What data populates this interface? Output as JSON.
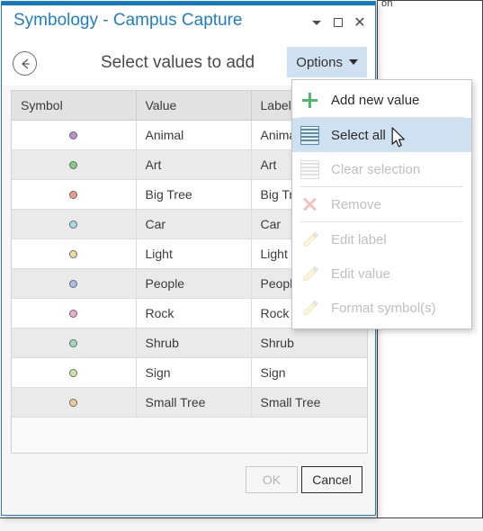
{
  "background_window": {
    "tab_label": "on"
  },
  "dialog": {
    "title": "Symbology - Campus Capture",
    "window_controls": [
      {
        "name": "minimize-dropdown",
        "glyph": "caret-down"
      },
      {
        "name": "maximize-restore",
        "glyph": "square"
      },
      {
        "name": "close",
        "glyph": "✕"
      }
    ],
    "close_glyph": "✕",
    "header": {
      "back_button_label": "←",
      "page_title": "Select values to add",
      "options_label": "Options"
    },
    "table": {
      "columns": [
        "Symbol",
        "Value",
        "Label"
      ],
      "rows": [
        {
          "symbol_color": "#b98fd6",
          "value": "Animal",
          "label": "Animal"
        },
        {
          "symbol_color": "#7fcf7f",
          "value": "Art",
          "label": "Art"
        },
        {
          "symbol_color": "#ef9a8e",
          "value": "Big Tree",
          "label": "Big Tree"
        },
        {
          "symbol_color": "#a5dbe8",
          "value": "Car",
          "label": "Car"
        },
        {
          "symbol_color": "#f2dc9a",
          "value": "Light",
          "label": "Light"
        },
        {
          "symbol_color": "#a9bce8",
          "value": "People",
          "label": "People"
        },
        {
          "symbol_color": "#eaabd6",
          "value": "Rock",
          "label": "Rock"
        },
        {
          "symbol_color": "#9bdcb8",
          "value": "Shrub",
          "label": "Shrub"
        },
        {
          "symbol_color": "#c7e8a0",
          "value": "Sign",
          "label": "Sign"
        },
        {
          "symbol_color": "#f0c79a",
          "value": "Small Tree",
          "label": "Small Tree"
        }
      ]
    },
    "footer": {
      "ok_label": "OK",
      "ok_enabled": false,
      "cancel_label": "Cancel"
    }
  },
  "options_menu": {
    "open": true,
    "items": [
      {
        "label": "Add new value",
        "icon": "plus-icon",
        "enabled": true,
        "selected": false,
        "separator_after": true
      },
      {
        "label": "Select all",
        "icon": "select-all-icon",
        "enabled": true,
        "selected": true,
        "separator_after": false
      },
      {
        "label": "Clear selection",
        "icon": "clear-selection-icon",
        "enabled": false,
        "selected": false,
        "separator_after": true
      },
      {
        "label": "Remove",
        "icon": "remove-x-icon",
        "enabled": false,
        "selected": false,
        "separator_after": true
      },
      {
        "label": "Edit label",
        "icon": "pencil-icon",
        "enabled": false,
        "selected": false,
        "separator_after": false
      },
      {
        "label": "Edit value",
        "icon": "pencil-icon",
        "enabled": false,
        "selected": false,
        "separator_after": false
      },
      {
        "label": "Format symbol(s)",
        "icon": "pencil-icon",
        "enabled": false,
        "selected": false,
        "separator_after": false
      }
    ]
  },
  "colors": {
    "accent": "#1278be",
    "title_text": "#1f7fc4",
    "highlight": "#cfe0f0",
    "dialog_border": "#2e7cc4"
  }
}
